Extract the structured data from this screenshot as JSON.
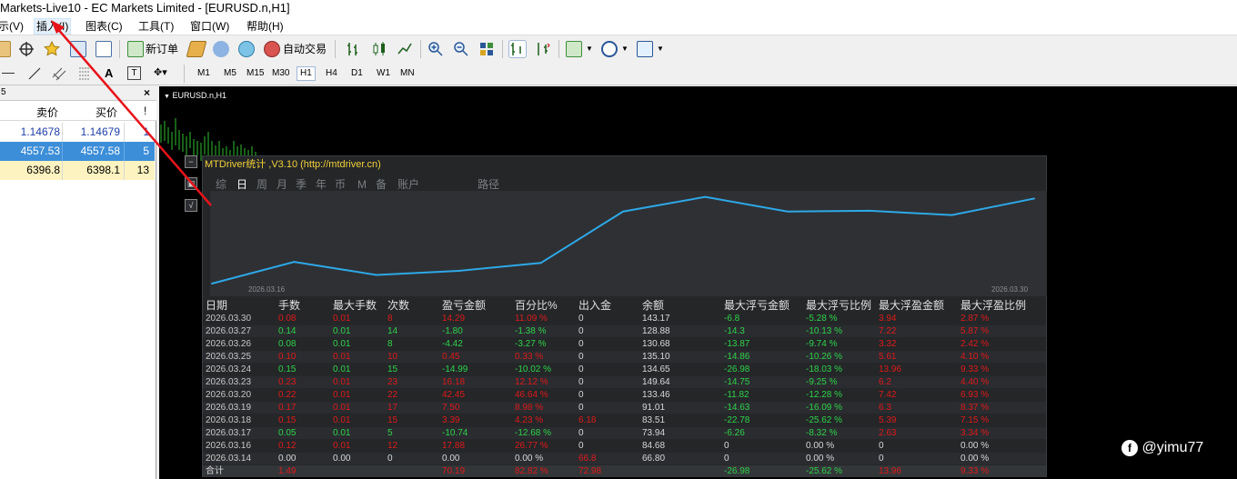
{
  "window": {
    "title": "Markets-Live10 - EC Markets Limited - [EURUSD.n,H1]"
  },
  "menu": {
    "items": [
      "示(V)",
      "插入(I)",
      "图表(C)",
      "工具(T)",
      "窗口(W)",
      "帮助(H)"
    ]
  },
  "toolbar": {
    "new_order": "新订单",
    "auto_trade": "自动交易",
    "text_tool": "A",
    "timeframes": [
      "M1",
      "M5",
      "M15",
      "M30",
      "H1",
      "H4",
      "D1",
      "W1",
      "MN"
    ],
    "active_timeframe": "H1"
  },
  "market_watch": {
    "header_text": "5",
    "columns": [
      "卖价",
      "买价",
      "!"
    ],
    "rows": [
      {
        "bid": "1.14678",
        "ask": "1.14679",
        "spread": "1",
        "selected": false,
        "highlight": false
      },
      {
        "bid": "4557.53",
        "ask": "4557.58",
        "spread": "5",
        "selected": true,
        "highlight": false
      },
      {
        "bid": "6396.8",
        "ask": "6398.1",
        "spread": "13",
        "selected": false,
        "highlight": true
      }
    ]
  },
  "chart": {
    "symbol_label": "EURUSD.n,H1"
  },
  "stats": {
    "title": "MTDriver统计 ,V3.10 (http://mtdriver.cn)",
    "tabs": [
      "综",
      "日",
      "周",
      "月",
      "季",
      "年",
      "币",
      "M",
      "备",
      "账户",
      "路径"
    ],
    "active_tab": "日",
    "chart_start_date": "2026.03.16",
    "chart_end_date": "2026.03.30",
    "chart_data": {
      "type": "line",
      "x": [
        "2026.03.16",
        "2026.03.17",
        "2026.03.18",
        "2026.03.19",
        "2026.03.20",
        "2026.03.23",
        "2026.03.24",
        "2026.03.25",
        "2026.03.26",
        "2026.03.27",
        "2026.03.30"
      ],
      "series": [
        {
          "values": [
            0,
            17.88,
            7.14,
            10.53,
            17.03,
            59.45,
            71.53,
            59.44,
            60.07,
            56.52,
            70.16
          ]
        }
      ]
    },
    "headers": [
      "日期",
      "手数",
      "最大手数",
      "次数",
      "盈亏金额",
      "百分比%",
      "出入金",
      "余额",
      "最大浮亏金额",
      "最大浮亏比例",
      "最大浮盈金额",
      "最大浮盈比例"
    ],
    "rows": [
      [
        "2026.03.30",
        "0.08",
        "0.01",
        "8",
        "14.29",
        "11.09 %",
        "0",
        "143.17",
        "-6.8",
        "-5.28 %",
        "3.94",
        "2.87 %"
      ],
      [
        "2026.03.27",
        "0.14",
        "0.01",
        "14",
        "-1.80",
        "-1.38 %",
        "0",
        "128.88",
        "-14.3",
        "-10.13 %",
        "7.22",
        "5.87 %"
      ],
      [
        "2026.03.26",
        "0.08",
        "0.01",
        "8",
        "-4.42",
        "-3.27 %",
        "0",
        "130.68",
        "-13.87",
        "-9.74 %",
        "3.32",
        "2.42 %"
      ],
      [
        "2026.03.25",
        "0.10",
        "0.01",
        "10",
        "0.45",
        "0.33 %",
        "0",
        "135.10",
        "-14.86",
        "-10.26 %",
        "5.61",
        "4.10 %"
      ],
      [
        "2026.03.24",
        "0.15",
        "0.01",
        "15",
        "-14.99",
        "-10.02 %",
        "0",
        "134.65",
        "-26.98",
        "-18.03 %",
        "13.96",
        "9.33 %"
      ],
      [
        "2026.03.23",
        "0.23",
        "0.01",
        "23",
        "16.18",
        "12.12 %",
        "0",
        "149.64",
        "-14.75",
        "-9.25 %",
        "6.2",
        "4.40 %"
      ],
      [
        "2026.03.20",
        "0.22",
        "0.01",
        "22",
        "42.45",
        "46.64 %",
        "0",
        "133.46",
        "-11.82",
        "-12.28 %",
        "7.42",
        "6.93 %"
      ],
      [
        "2026.03.19",
        "0.17",
        "0.01",
        "17",
        "7.50",
        "8.98 %",
        "0",
        "91.01",
        "-14.63",
        "-16.09 %",
        "6.3",
        "8.37 %"
      ],
      [
        "2026.03.18",
        "0.15",
        "0.01",
        "15",
        "3.39",
        "4.23 %",
        "6.18",
        "83.51",
        "-22.78",
        "-25.62 %",
        "5.39",
        "7.15 %"
      ],
      [
        "2026.03.17",
        "0.05",
        "0.01",
        "5",
        "-10.74",
        "-12.68 %",
        "0",
        "73.94",
        "-6.26",
        "-8.32 %",
        "2.63",
        "3.34 %"
      ],
      [
        "2026.03.16",
        "0.12",
        "0.01",
        "12",
        "17.88",
        "26.77 %",
        "0",
        "84.68",
        "0",
        "0.00 %",
        "0",
        "0.00 %"
      ],
      [
        "2026.03.14",
        "0.00",
        "0.00",
        "0",
        "0.00",
        "0.00 %",
        "66.8",
        "66.80",
        "0",
        "0.00 %",
        "0",
        "0.00 %"
      ]
    ],
    "total": [
      "合计",
      "1.49",
      "",
      "",
      "70.19",
      "82.82 %",
      "72.98",
      "",
      "-26.98",
      "-25.62 %",
      "13.96",
      "9.33 %"
    ]
  },
  "watermark": "@yimu77",
  "colors": {
    "loss": "#e01a1a",
    "profit": "#2fd34a",
    "title_yellow": "#f2d13a",
    "line_blue": "#2ea8e6",
    "selected_row": "#3c8ed8",
    "highlight_row": "#fdf3c0"
  }
}
